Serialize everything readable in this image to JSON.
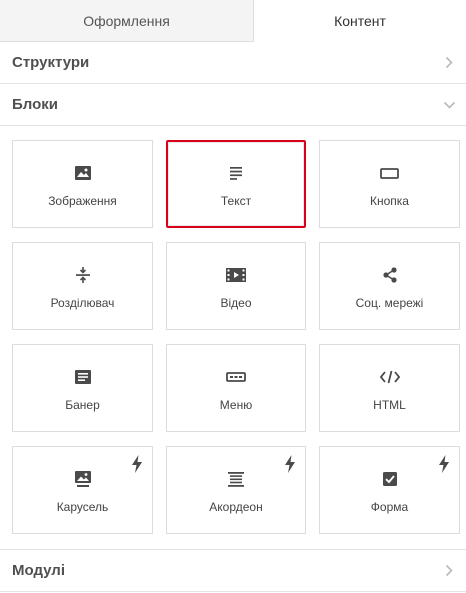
{
  "tabs": [
    {
      "label": "Оформлення",
      "active": false
    },
    {
      "label": "Контент",
      "active": true
    }
  ],
  "sections": {
    "structures": {
      "title": "Структури",
      "icon": "chevron-right-icon"
    },
    "blocks": {
      "title": "Блоки",
      "icon": "chevron-down-icon"
    },
    "modules": {
      "title": "Модулі",
      "icon": "chevron-right-icon"
    }
  },
  "blocks": [
    {
      "label": "Зображення",
      "icon": "image-icon",
      "selected": false,
      "pro": false
    },
    {
      "label": "Текст",
      "icon": "text-icon",
      "selected": true,
      "pro": false
    },
    {
      "label": "Кнопка",
      "icon": "button-icon",
      "selected": false,
      "pro": false
    },
    {
      "label": "Розділювач",
      "icon": "divider-icon",
      "selected": false,
      "pro": false
    },
    {
      "label": "Відео",
      "icon": "video-icon",
      "selected": false,
      "pro": false
    },
    {
      "label": "Соц. мережі",
      "icon": "share-icon",
      "selected": false,
      "pro": false
    },
    {
      "label": "Банер",
      "icon": "banner-icon",
      "selected": false,
      "pro": false
    },
    {
      "label": "Меню",
      "icon": "menu-icon",
      "selected": false,
      "pro": false
    },
    {
      "label": "HTML",
      "icon": "code-icon",
      "selected": false,
      "pro": false
    },
    {
      "label": "Карусель",
      "icon": "carousel-icon",
      "selected": false,
      "pro": true
    },
    {
      "label": "Акордеон",
      "icon": "accordion-icon",
      "selected": false,
      "pro": true
    },
    {
      "label": "Форма",
      "icon": "form-icon",
      "selected": false,
      "pro": true
    }
  ],
  "colors": {
    "selection_border": "#d9001b",
    "icon": "#4a4a4a",
    "tab_inactive_bg": "#f4f4f4"
  }
}
